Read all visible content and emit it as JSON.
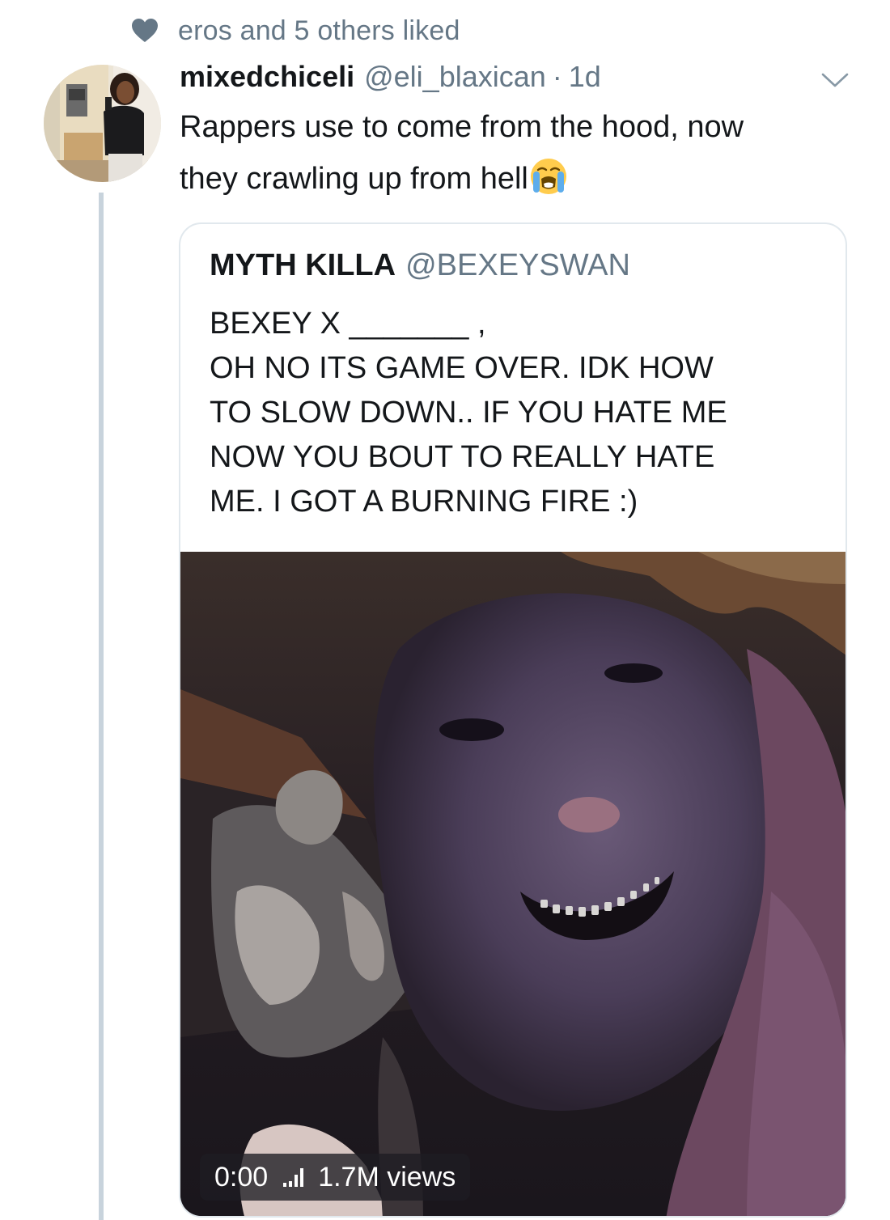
{
  "social_context": {
    "icon": "heart-icon",
    "text": "eros and 5 others liked"
  },
  "tweet": {
    "display_name": "mixedchiceli",
    "handle": "@eli_blaxican",
    "separator": "·",
    "time": "1d",
    "text_lines": [
      "Rappers use to come from the hood, now",
      "they crawling up from hell"
    ],
    "emoji": "loudly-crying-face-icon",
    "menu_icon": "chevron-down-icon"
  },
  "quoted_tweet": {
    "display_name": "MYTH KILLA",
    "handle": "@BEXEYSWAN",
    "text_lines": [
      "BEXEY X _______ ,",
      "OH NO ITS GAME OVER. IDK HOW",
      "TO SLOW DOWN.. IF YOU HATE ME",
      "NOW YOU BOUT TO REALLY HATE",
      "ME. I GOT A BURNING FIRE :)"
    ],
    "video": {
      "duration": "0:00",
      "views": "1.7M views",
      "icon": "volume-bars-icon"
    }
  },
  "colors": {
    "secondary_text": "#657786",
    "primary_text": "#14171a",
    "thread_line": "#c8d3dc",
    "card_border": "#e1e8ed"
  }
}
